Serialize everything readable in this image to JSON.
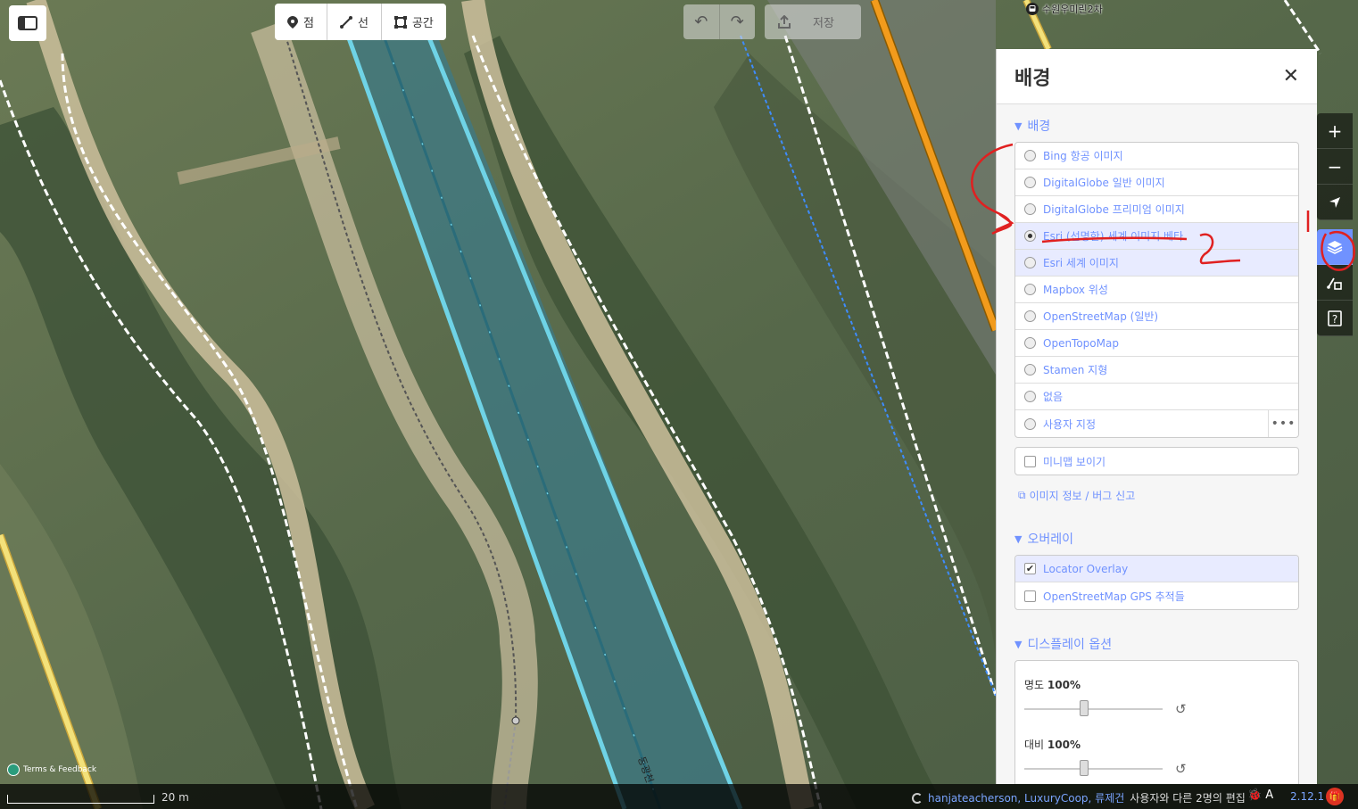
{
  "toolbar": {
    "modes": [
      {
        "label": "점",
        "icon": "point-icon"
      },
      {
        "label": "선",
        "icon": "line-icon"
      },
      {
        "label": "공간",
        "icon": "area-icon"
      }
    ],
    "save_label": "저장"
  },
  "map": {
    "bus_stop_label": "수원우미린2차",
    "river_label": "동광천",
    "attribution": "Terms & Feedback"
  },
  "pane": {
    "title": "배경",
    "background_section": {
      "title": "배경",
      "options": [
        {
          "label": "Bing 항공 이미지",
          "selected": false
        },
        {
          "label": "DigitalGlobe 일반 이미지",
          "selected": false
        },
        {
          "label": "DigitalGlobe 프리미엄 이미지",
          "selected": false
        },
        {
          "label": "Esri (선명한) 세계 이미지 베타",
          "selected": true
        },
        {
          "label": "Esri 세계 이미지",
          "selected": false
        },
        {
          "label": "Mapbox 위성",
          "selected": false
        },
        {
          "label": "OpenStreetMap (일반)",
          "selected": false
        },
        {
          "label": "OpenTopoMap",
          "selected": false
        },
        {
          "label": "Stamen 지형",
          "selected": false
        },
        {
          "label": "없음",
          "selected": false
        },
        {
          "label": "사용자 지정",
          "selected": false
        }
      ],
      "minimap_label": "미니맵 보이기",
      "imagery_info_label": "이미지 정보 / 버그 신고"
    },
    "overlay_section": {
      "title": "오버레이",
      "options": [
        {
          "label": "Locator Overlay",
          "checked": true
        },
        {
          "label": "OpenStreetMap GPS 추적들",
          "checked": false
        }
      ]
    },
    "display_section": {
      "title": "디스플레이 옵션",
      "sliders": [
        {
          "label": "명도",
          "value": "100%"
        },
        {
          "label": "대비",
          "value": "100%"
        }
      ]
    }
  },
  "footer": {
    "scale_label": "20 m",
    "contributors": "hanjateacherson, LuxuryCoop, 류제건",
    "contributors_suffix": "사용자와 다른 2명의 편집",
    "version": "2.12.1"
  },
  "colors": {
    "accent": "#7092ff",
    "waterway": "#5fc9dc",
    "annotation": "#e02020"
  }
}
